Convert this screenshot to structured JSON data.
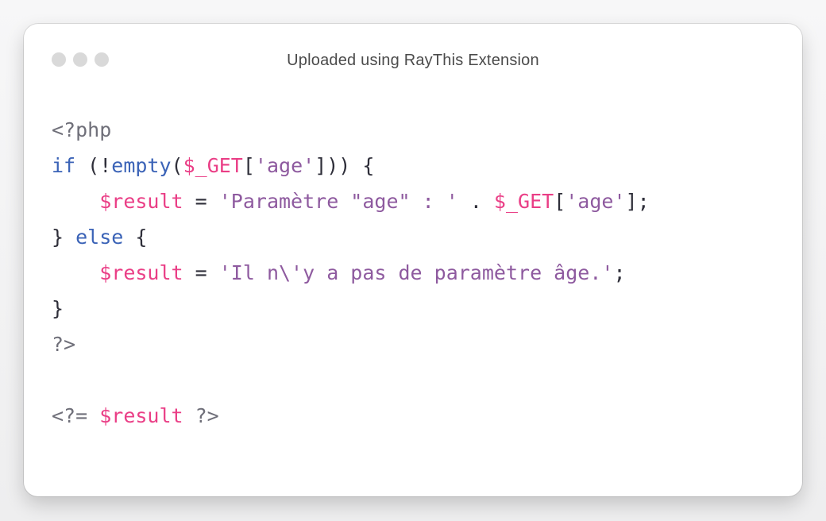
{
  "window": {
    "title": "Uploaded using RayThis Extension",
    "traffic_lights": [
      "close-dot",
      "minimize-dot",
      "maximize-dot"
    ],
    "dot_color": "#d9d9d9"
  },
  "code": {
    "language": "php",
    "colors": {
      "keyword": "#3b63b7",
      "variable": "#ea3e86",
      "string": "#8e5a9f",
      "meta": "#6f6f79",
      "text": "#2f2f3a"
    },
    "lines": [
      [
        {
          "type": "meta",
          "text": "<?php"
        }
      ],
      [
        {
          "type": "kw",
          "text": "if"
        },
        {
          "type": "punc",
          "text": " (!"
        },
        {
          "type": "fn",
          "text": "empty"
        },
        {
          "type": "punc",
          "text": "("
        },
        {
          "type": "var",
          "text": "$_GET"
        },
        {
          "type": "punc",
          "text": "["
        },
        {
          "type": "str",
          "text": "'age'"
        },
        {
          "type": "punc",
          "text": "])) {"
        }
      ],
      [
        {
          "type": "punc",
          "text": "    "
        },
        {
          "type": "var",
          "text": "$result"
        },
        {
          "type": "punc",
          "text": " = "
        },
        {
          "type": "str",
          "text": "'Paramètre \"age\" : '"
        },
        {
          "type": "punc",
          "text": " . "
        },
        {
          "type": "var",
          "text": "$_GET"
        },
        {
          "type": "punc",
          "text": "["
        },
        {
          "type": "str",
          "text": "'age'"
        },
        {
          "type": "punc",
          "text": "];"
        }
      ],
      [
        {
          "type": "punc",
          "text": "} "
        },
        {
          "type": "kw",
          "text": "else"
        },
        {
          "type": "punc",
          "text": " {"
        }
      ],
      [
        {
          "type": "punc",
          "text": "    "
        },
        {
          "type": "var",
          "text": "$result"
        },
        {
          "type": "punc",
          "text": " = "
        },
        {
          "type": "str",
          "text": "'Il n\\'y a pas de paramètre âge.'"
        },
        {
          "type": "punc",
          "text": ";"
        }
      ],
      [
        {
          "type": "punc",
          "text": "}"
        }
      ],
      [
        {
          "type": "meta",
          "text": "?>"
        }
      ],
      [
        {
          "type": "punc",
          "text": ""
        }
      ],
      [
        {
          "type": "meta",
          "text": "<?= "
        },
        {
          "type": "var",
          "text": "$result"
        },
        {
          "type": "meta",
          "text": " ?>"
        }
      ]
    ]
  }
}
